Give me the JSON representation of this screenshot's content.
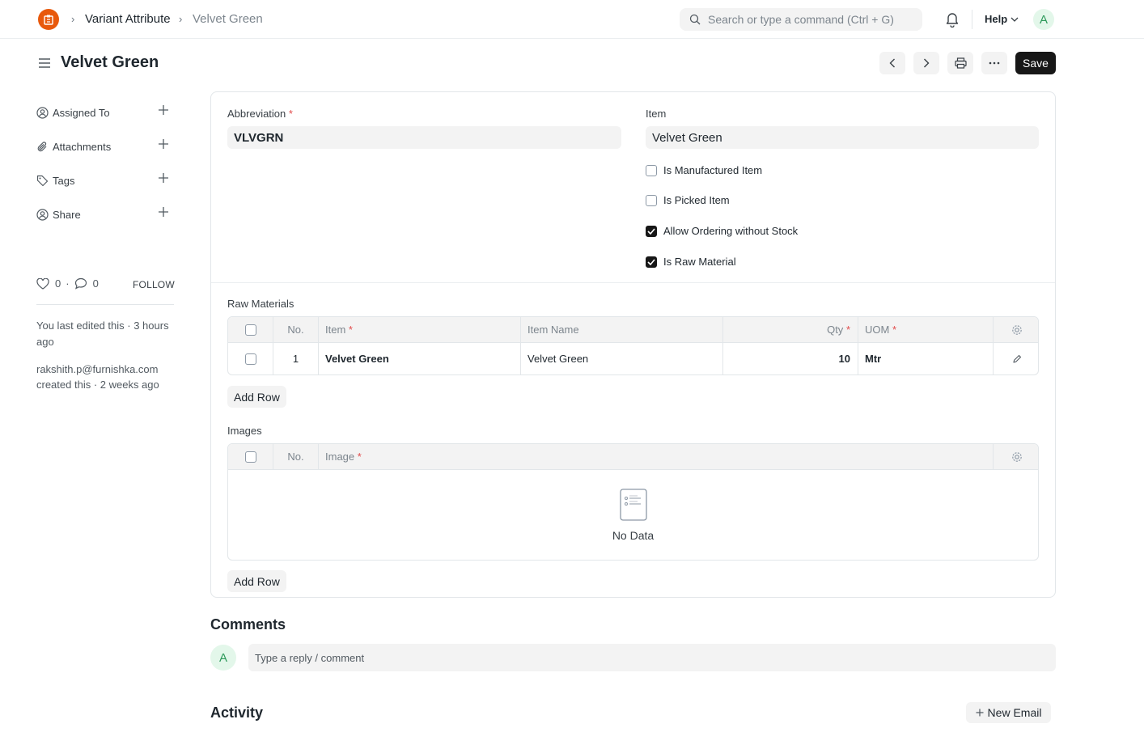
{
  "navbar": {
    "breadcrumbs": [
      "Variant Attribute",
      "Velvet Green"
    ],
    "search_placeholder": "Search or type a command (Ctrl + G)",
    "help_label": "Help",
    "avatar_initial": "A"
  },
  "page": {
    "title": "Velvet Green",
    "save_label": "Save"
  },
  "sidebar": {
    "items": [
      {
        "label": "Assigned To",
        "icon": "assign-icon"
      },
      {
        "label": "Attachments",
        "icon": "paperclip-icon"
      },
      {
        "label": "Tags",
        "icon": "tag-icon"
      },
      {
        "label": "Share",
        "icon": "share-icon"
      }
    ],
    "likes_count": "0",
    "comments_count": "0",
    "follow_label": "FOLLOW",
    "last_edited": "You last edited this · 3 hours ago",
    "creator_email": "rakshith.p@furnishka.com",
    "created_text": "created this · 2 weeks ago"
  },
  "form": {
    "abbreviation_label": "Abbreviation",
    "abbreviation_value": "VLVGRN",
    "item_label": "Item",
    "item_value": "Velvet Green",
    "required_mark": "*",
    "checkboxes": [
      {
        "label": "Is Manufactured Item",
        "checked": false
      },
      {
        "label": "Is Picked Item",
        "checked": false
      },
      {
        "label": "Allow Ordering without Stock",
        "checked": true
      },
      {
        "label": "Is Raw Material",
        "checked": true
      }
    ]
  },
  "raw_materials": {
    "label": "Raw Materials",
    "columns": {
      "no": "No.",
      "item": "Item",
      "item_name": "Item Name",
      "qty": "Qty",
      "uom": "UOM"
    },
    "rows": [
      {
        "no": "1",
        "item": "Velvet Green",
        "item_name": "Velvet Green",
        "qty": "10",
        "uom": "Mtr"
      }
    ],
    "add_row_label": "Add Row"
  },
  "images": {
    "label": "Images",
    "columns": {
      "no": "No.",
      "image": "Image"
    },
    "empty_text": "No Data",
    "add_row_label": "Add Row"
  },
  "comments": {
    "title": "Comments",
    "avatar_initial": "A",
    "placeholder": "Type a reply / comment"
  },
  "activity": {
    "title": "Activity",
    "new_email_label": "New Email"
  },
  "colors": {
    "brand": "#e8590c",
    "primary_button": "#171717",
    "required": "#e24c4c"
  }
}
